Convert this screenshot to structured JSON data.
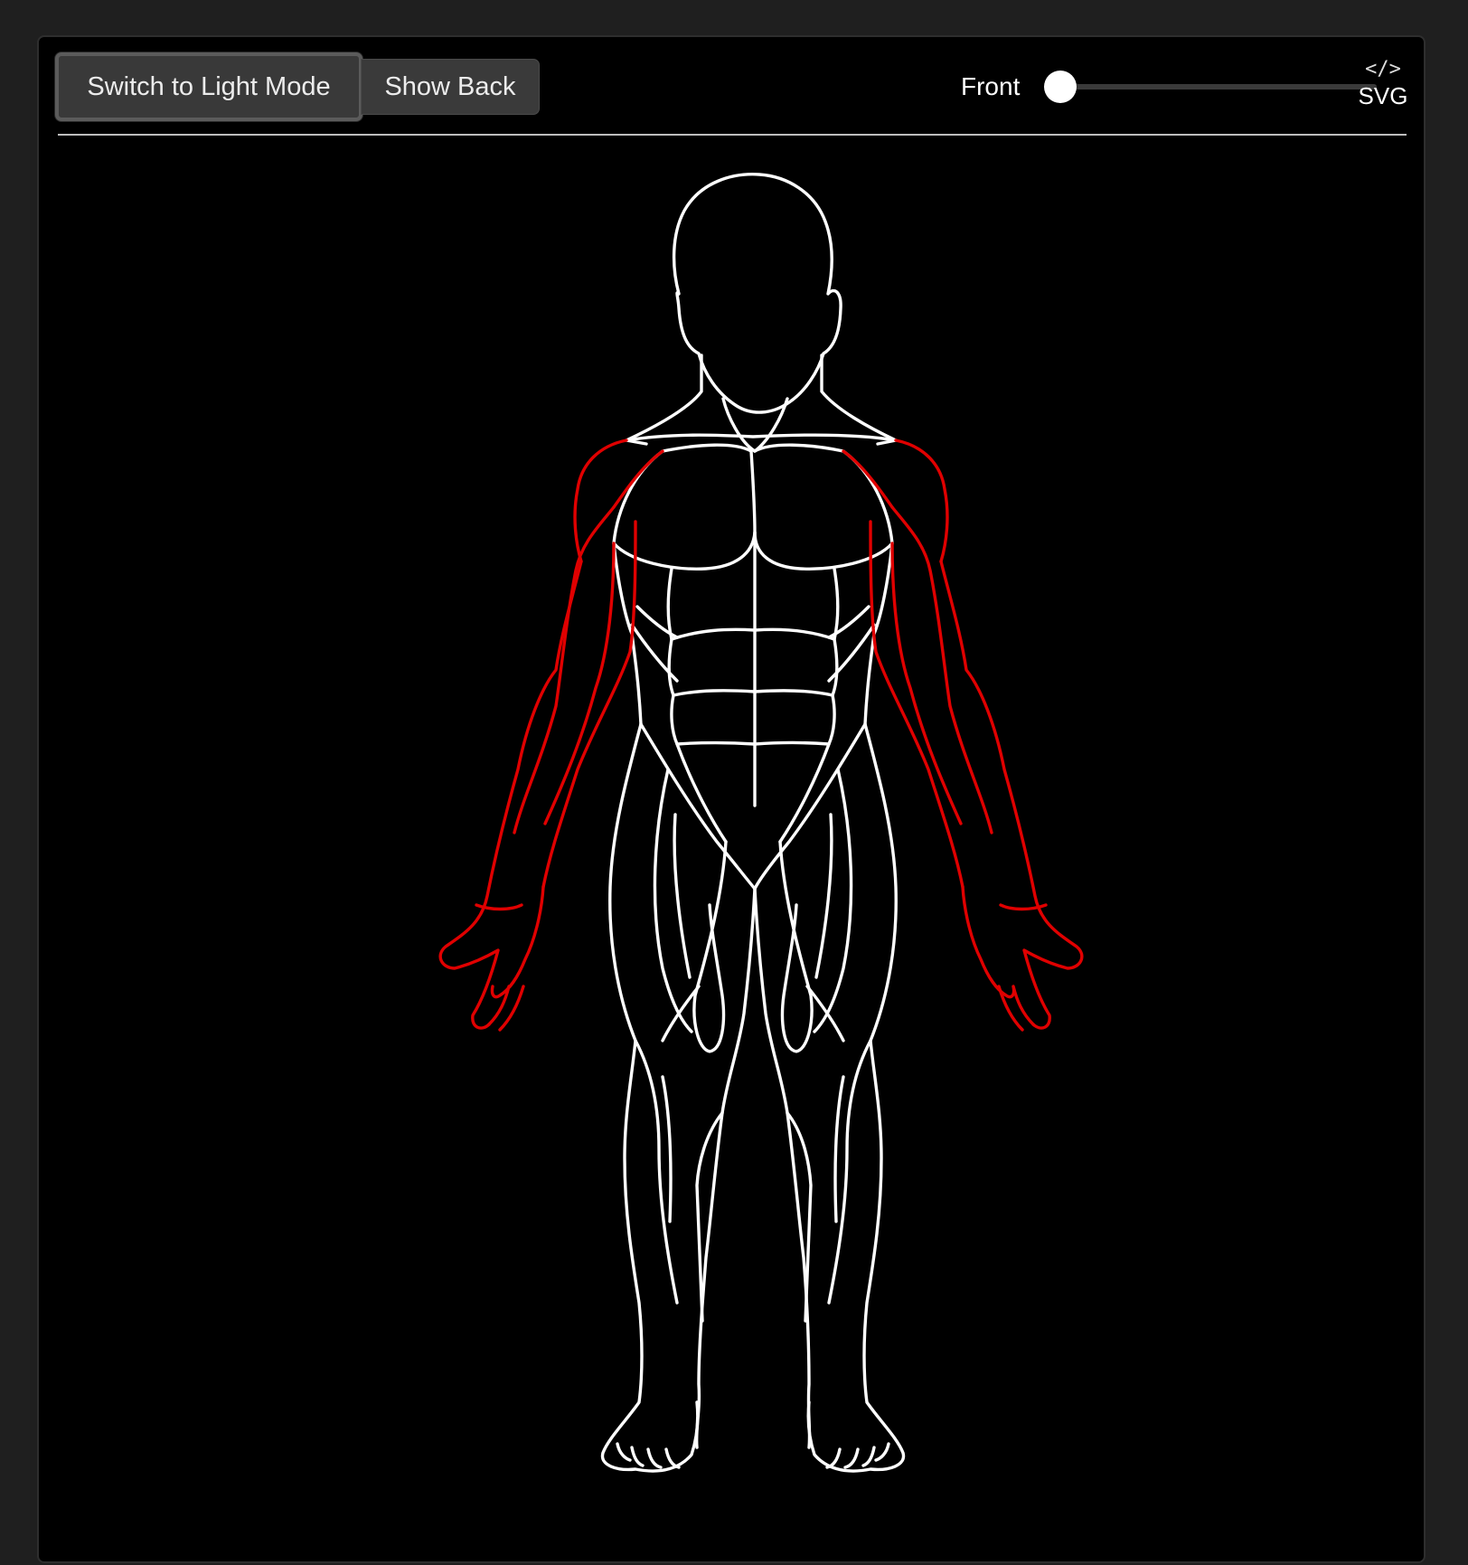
{
  "toolbar": {
    "theme_button_label": "Switch to Light Mode",
    "side_button_label": "Show Back",
    "view_label": "Front",
    "view_slider_value": 0,
    "export_icon": "code-icon",
    "export_label": "SVG"
  },
  "figure": {
    "view": "front",
    "outline_color": "#ffffff",
    "highlighted_regions": [
      "shoulders",
      "arms",
      "hands"
    ],
    "highlight_color": "#e00000",
    "background_color": "#000000"
  }
}
